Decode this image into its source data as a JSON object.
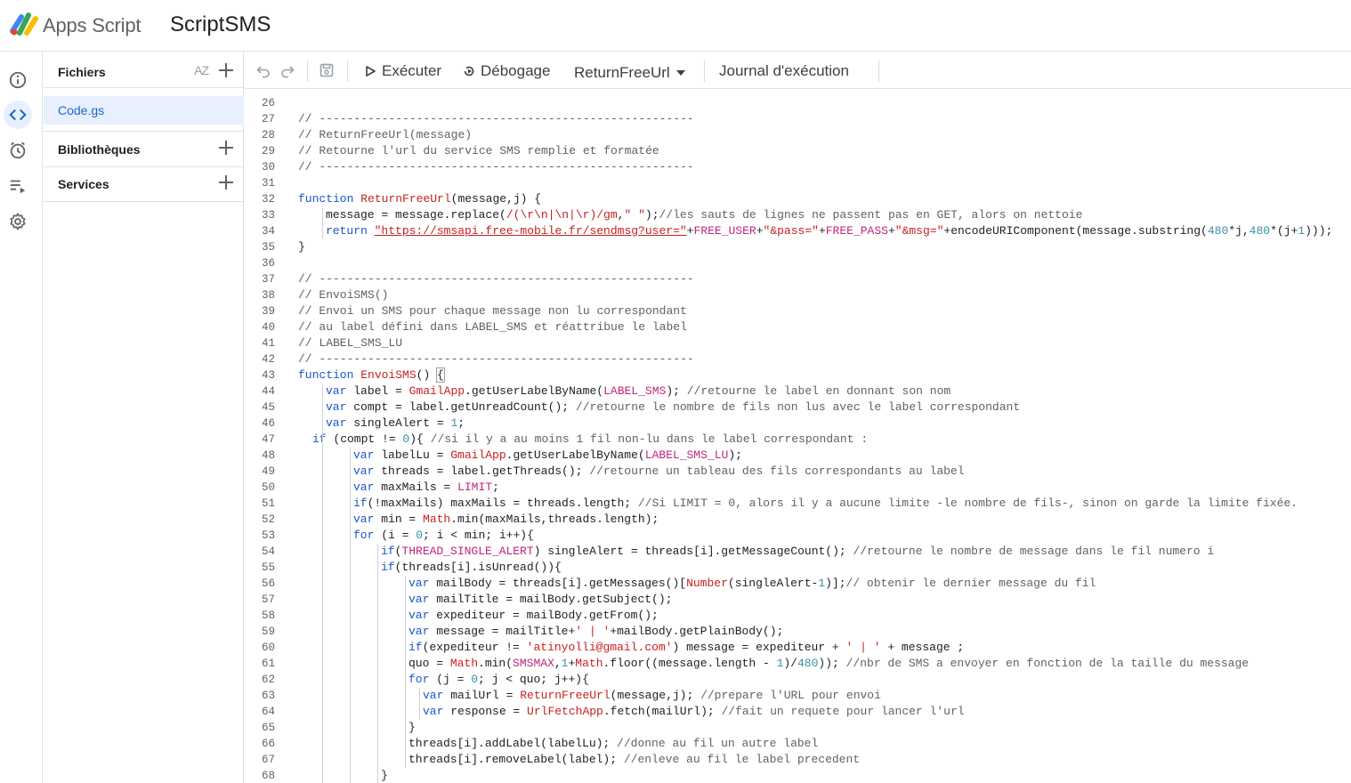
{
  "app": {
    "name": "Apps Script",
    "project": "ScriptSMS"
  },
  "rail": {
    "icons": [
      "info-icon",
      "code-icon",
      "clock-icon",
      "executions-icon",
      "gear-icon"
    ]
  },
  "files_panel": {
    "files_label": "Fichiers",
    "sort_label": "AZ",
    "file": "Code.gs",
    "libraries_label": "Bibliothèques",
    "services_label": "Services"
  },
  "toolbar": {
    "run_label": "Exécuter",
    "debug_label": "Débogage",
    "function_select": "ReturnFreeUrl",
    "log_label": "Journal d'exécution"
  },
  "editor": {
    "lines": [
      {
        "n": "26",
        "ind": 0,
        "t": []
      },
      {
        "n": "27",
        "ind": 0,
        "t": [
          [
            "c",
            "// ------------------------------------------------------"
          ]
        ]
      },
      {
        "n": "28",
        "ind": 0,
        "t": [
          [
            "c",
            "// ReturnFreeUrl(message)"
          ]
        ]
      },
      {
        "n": "29",
        "ind": 0,
        "t": [
          [
            "c",
            "// Retourne l'url du service SMS remplie et formatée"
          ]
        ]
      },
      {
        "n": "30",
        "ind": 0,
        "t": [
          [
            "c",
            "// ------------------------------------------------------"
          ]
        ]
      },
      {
        "n": "31",
        "ind": 0,
        "t": []
      },
      {
        "n": "32",
        "ind": 0,
        "t": [
          [
            "k",
            "function "
          ],
          [
            "f",
            "ReturnFreeUrl"
          ],
          [
            "p",
            "(message,j) {"
          ]
        ]
      },
      {
        "n": "33",
        "ind": 1,
        "t": [
          [
            "p",
            "message = message.replace("
          ],
          [
            "s",
            "/(\\r\\n|\\n|\\r)/gm"
          ],
          [
            "p",
            ","
          ],
          [
            "s",
            "\" \""
          ],
          [
            "p",
            ");"
          ],
          [
            "c",
            "//les sauts de lignes ne passent pas en GET, alors on nettoie"
          ]
        ]
      },
      {
        "n": "34",
        "ind": 1,
        "t": [
          [
            "k",
            "return "
          ],
          [
            "u",
            "\"https://smsapi.free-mobile.fr/sendmsg?user=\""
          ],
          [
            "p",
            "+"
          ],
          [
            "g",
            "FREE_USER"
          ],
          [
            "p",
            "+"
          ],
          [
            "s",
            "\"&pass=\""
          ],
          [
            "p",
            "+"
          ],
          [
            "g",
            "FREE_PASS"
          ],
          [
            "p",
            "+"
          ],
          [
            "s",
            "\"&msg=\""
          ],
          [
            "p",
            "+encodeURIComponent(message.substring("
          ],
          [
            "n",
            "480"
          ],
          [
            "p",
            "*j,"
          ],
          [
            "n",
            "480"
          ],
          [
            "p",
            "*(j+"
          ],
          [
            "n",
            "1"
          ],
          [
            "p",
            ")));"
          ]
        ]
      },
      {
        "n": "35",
        "ind": 0,
        "t": [
          [
            "p",
            "}"
          ]
        ]
      },
      {
        "n": "36",
        "ind": 0,
        "t": []
      },
      {
        "n": "37",
        "ind": 0,
        "t": [
          [
            "c",
            "// ------------------------------------------------------"
          ]
        ]
      },
      {
        "n": "38",
        "ind": 0,
        "t": [
          [
            "c",
            "// EnvoiSMS()"
          ]
        ]
      },
      {
        "n": "39",
        "ind": 0,
        "t": [
          [
            "c",
            "// Envoi un SMS pour chaque message non lu correspondant"
          ]
        ]
      },
      {
        "n": "40",
        "ind": 0,
        "t": [
          [
            "c",
            "// au label défini dans LABEL_SMS et réattribue le label"
          ]
        ]
      },
      {
        "n": "41",
        "ind": 0,
        "t": [
          [
            "c",
            "// LABEL_SMS_LU"
          ]
        ]
      },
      {
        "n": "42",
        "ind": 0,
        "t": [
          [
            "c",
            "// ------------------------------------------------------"
          ]
        ]
      },
      {
        "n": "43",
        "ind": 0,
        "t": [
          [
            "k",
            "function "
          ],
          [
            "f",
            "EnvoiSMS"
          ],
          [
            "p",
            "() "
          ],
          [
            "b",
            "{"
          ]
        ]
      },
      {
        "n": "44",
        "ind": 1,
        "t": [
          [
            "k",
            "var "
          ],
          [
            "p",
            "label = "
          ],
          [
            "f",
            "GmailApp"
          ],
          [
            "p",
            ".getUserLabelByName("
          ],
          [
            "g",
            "LABEL_SMS"
          ],
          [
            "p",
            "); "
          ],
          [
            "c",
            "//retourne le label en donnant son nom"
          ]
        ]
      },
      {
        "n": "45",
        "ind": 1,
        "t": [
          [
            "k",
            "var "
          ],
          [
            "p",
            "compt = label.getUnreadCount(); "
          ],
          [
            "c",
            "//retourne le nombre de fils non lus avec le label correspondant"
          ]
        ]
      },
      {
        "n": "46",
        "ind": 1,
        "t": [
          [
            "k",
            "var "
          ],
          [
            "p",
            "singleAlert = "
          ],
          [
            "n",
            "1"
          ],
          [
            "p",
            ";"
          ]
        ]
      },
      {
        "n": "47",
        "ind": 2,
        "t": [
          [
            "k",
            "if "
          ],
          [
            "p",
            "(compt != "
          ],
          [
            "n",
            "0"
          ],
          [
            "p",
            "){ "
          ],
          [
            "c",
            "//si il y a au moins 1 fil non-lu dans le label correspondant :"
          ]
        ]
      },
      {
        "n": "48",
        "ind": 3,
        "t": [
          [
            "k",
            "var "
          ],
          [
            "p",
            "labelLu = "
          ],
          [
            "f",
            "GmailApp"
          ],
          [
            "p",
            ".getUserLabelByName("
          ],
          [
            "g",
            "LABEL_SMS_LU"
          ],
          [
            "p",
            ");"
          ]
        ]
      },
      {
        "n": "49",
        "ind": 3,
        "t": [
          [
            "k",
            "var "
          ],
          [
            "p",
            "threads = label.getThreads(); "
          ],
          [
            "c",
            "//retourne un tableau des fils correspondants au label"
          ]
        ]
      },
      {
        "n": "50",
        "ind": 3,
        "t": [
          [
            "k",
            "var "
          ],
          [
            "p",
            "maxMails = "
          ],
          [
            "g",
            "LIMIT"
          ],
          [
            "p",
            ";"
          ]
        ]
      },
      {
        "n": "51",
        "ind": 3,
        "t": [
          [
            "k",
            "if"
          ],
          [
            "p",
            "(!maxMails) maxMails = threads.length; "
          ],
          [
            "c",
            "//Si LIMIT = 0, alors il y a aucune limite -le nombre de fils-, sinon on garde la limite fixée."
          ]
        ]
      },
      {
        "n": "52",
        "ind": 3,
        "t": [
          [
            "k",
            "var "
          ],
          [
            "p",
            "min = "
          ],
          [
            "f",
            "Math"
          ],
          [
            "p",
            ".min(maxMails,threads.length);"
          ]
        ]
      },
      {
        "n": "53",
        "ind": 3,
        "t": [
          [
            "k",
            "for "
          ],
          [
            "p",
            "(i = "
          ],
          [
            "n",
            "0"
          ],
          [
            "p",
            "; i < min; i++){"
          ]
        ]
      },
      {
        "n": "54",
        "ind": 4,
        "t": [
          [
            "k",
            "if"
          ],
          [
            "p",
            "("
          ],
          [
            "g",
            "THREAD_SINGLE_ALERT"
          ],
          [
            "p",
            ") singleAlert = threads[i].getMessageCount(); "
          ],
          [
            "c",
            "//retourne le nombre de message dans le fil numero i"
          ]
        ]
      },
      {
        "n": "55",
        "ind": 4,
        "t": [
          [
            "k",
            "if"
          ],
          [
            "p",
            "(threads[i].isUnread()){"
          ]
        ]
      },
      {
        "n": "56",
        "ind": 5,
        "t": [
          [
            "k",
            "var "
          ],
          [
            "p",
            "mailBody = threads[i].getMessages()["
          ],
          [
            "f",
            "Number"
          ],
          [
            "p",
            "(singleAlert-"
          ],
          [
            "n",
            "1"
          ],
          [
            "p",
            ")];"
          ],
          [
            "c",
            "// obtenir le dernier message du fil"
          ]
        ]
      },
      {
        "n": "57",
        "ind": 5,
        "t": [
          [
            "k",
            "var "
          ],
          [
            "p",
            "mailTitle = mailBody.getSubject();"
          ]
        ]
      },
      {
        "n": "58",
        "ind": 5,
        "t": [
          [
            "k",
            "var "
          ],
          [
            "p",
            "expediteur = mailBody.getFrom();"
          ]
        ]
      },
      {
        "n": "59",
        "ind": 5,
        "t": [
          [
            "k",
            "var "
          ],
          [
            "p",
            "message = mailTitle+"
          ],
          [
            "s",
            "' | '"
          ],
          [
            "p",
            "+mailBody.getPlainBody();"
          ]
        ]
      },
      {
        "n": "60",
        "ind": 5,
        "t": [
          [
            "k",
            "if"
          ],
          [
            "p",
            "(expediteur != "
          ],
          [
            "s",
            "'atinyolli@gmail.com'"
          ],
          [
            "p",
            ") message = expediteur + "
          ],
          [
            "s",
            "' | '"
          ],
          [
            "p",
            " + message ;"
          ]
        ]
      },
      {
        "n": "61",
        "ind": 5,
        "t": [
          [
            "p",
            "quo = "
          ],
          [
            "f",
            "Math"
          ],
          [
            "p",
            ".min("
          ],
          [
            "g",
            "SMSMAX"
          ],
          [
            "p",
            ","
          ],
          [
            "n",
            "1"
          ],
          [
            "p",
            "+"
          ],
          [
            "f",
            "Math"
          ],
          [
            "p",
            ".floor((message.length - "
          ],
          [
            "n",
            "1"
          ],
          [
            "p",
            ")/"
          ],
          [
            "n",
            "480"
          ],
          [
            "p",
            ")); "
          ],
          [
            "c",
            "//nbr de SMS a envoyer en fonction de la taille du message"
          ]
        ]
      },
      {
        "n": "62",
        "ind": 5,
        "t": [
          [
            "k",
            "for "
          ],
          [
            "p",
            "(j = "
          ],
          [
            "n",
            "0"
          ],
          [
            "p",
            "; j < quo; j++){"
          ]
        ]
      },
      {
        "n": "63",
        "ind": 6,
        "t": [
          [
            "k",
            "var "
          ],
          [
            "p",
            "mailUrl = "
          ],
          [
            "f",
            "ReturnFreeUrl"
          ],
          [
            "p",
            "(message,j); "
          ],
          [
            "c",
            "//prepare l'URL pour envoi"
          ]
        ]
      },
      {
        "n": "64",
        "ind": 6,
        "t": [
          [
            "k",
            "var "
          ],
          [
            "p",
            "response = "
          ],
          [
            "f",
            "UrlFetchApp"
          ],
          [
            "p",
            ".fetch(mailUrl); "
          ],
          [
            "c",
            "//fait un requete pour lancer l'url"
          ]
        ]
      },
      {
        "n": "65",
        "ind": 5,
        "t": [
          [
            "p",
            "}"
          ]
        ]
      },
      {
        "n": "66",
        "ind": 5,
        "t": [
          [
            "p",
            "threads[i].addLabel(labelLu); "
          ],
          [
            "c",
            "//donne au fil un autre label"
          ]
        ]
      },
      {
        "n": "67",
        "ind": 5,
        "t": [
          [
            "p",
            "threads[i].removeLabel(label); "
          ],
          [
            "c",
            "//enleve au fil le label precedent"
          ]
        ]
      },
      {
        "n": "68",
        "ind": 4,
        "t": [
          [
            "p",
            "}"
          ]
        ]
      }
    ]
  }
}
